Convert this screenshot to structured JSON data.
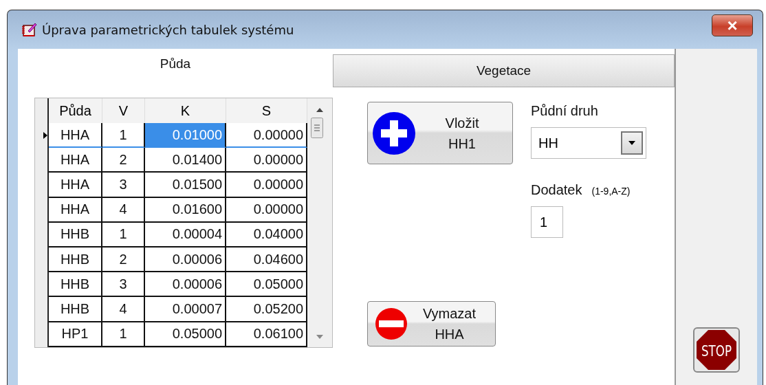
{
  "window": {
    "title": "Úprava parametrických tabulek systému",
    "close": "×"
  },
  "tabs": [
    {
      "label": "Půda",
      "selected": true
    },
    {
      "label": "Vegetace",
      "selected": false
    }
  ],
  "table": {
    "columns": [
      "Půda",
      "V",
      "K",
      "S"
    ],
    "rows": [
      {
        "current": true,
        "cells": [
          {
            "text": "HHA",
            "selected": false
          },
          {
            "text": "1",
            "selected": false
          },
          {
            "text": "0.01000",
            "selected": true
          },
          {
            "text": "0.00000",
            "selected": false
          }
        ]
      },
      {
        "current": false,
        "cells": [
          {
            "text": "HHA",
            "selected": false
          },
          {
            "text": "2",
            "selected": false
          },
          {
            "text": "0.01400",
            "selected": false
          },
          {
            "text": "0.00000",
            "selected": false
          }
        ]
      },
      {
        "current": false,
        "cells": [
          {
            "text": "HHA",
            "selected": false
          },
          {
            "text": "3",
            "selected": false
          },
          {
            "text": "0.01500",
            "selected": false
          },
          {
            "text": "0.00000",
            "selected": false
          }
        ]
      },
      {
        "current": false,
        "cells": [
          {
            "text": "HHA",
            "selected": false
          },
          {
            "text": "4",
            "selected": false
          },
          {
            "text": "0.01600",
            "selected": false
          },
          {
            "text": "0.00000",
            "selected": false
          }
        ]
      },
      {
        "current": false,
        "cells": [
          {
            "text": "HHB",
            "selected": false
          },
          {
            "text": "1",
            "selected": false
          },
          {
            "text": "0.00004",
            "selected": false
          },
          {
            "text": "0.04000",
            "selected": false
          }
        ]
      },
      {
        "current": false,
        "cells": [
          {
            "text": "HHB",
            "selected": false
          },
          {
            "text": "2",
            "selected": false
          },
          {
            "text": "0.00006",
            "selected": false
          },
          {
            "text": "0.04600",
            "selected": false
          }
        ]
      },
      {
        "current": false,
        "cells": [
          {
            "text": "HHB",
            "selected": false
          },
          {
            "text": "3",
            "selected": false
          },
          {
            "text": "0.00006",
            "selected": false
          },
          {
            "text": "0.05000",
            "selected": false
          }
        ]
      },
      {
        "current": false,
        "cells": [
          {
            "text": "HHB",
            "selected": false
          },
          {
            "text": "4",
            "selected": false
          },
          {
            "text": "0.00007",
            "selected": false
          },
          {
            "text": "0.05200",
            "selected": false
          }
        ]
      },
      {
        "current": false,
        "cells": [
          {
            "text": "HP1",
            "selected": false
          },
          {
            "text": "1",
            "selected": false
          },
          {
            "text": "0.05000",
            "selected": false
          },
          {
            "text": "0.06100",
            "selected": false
          }
        ]
      }
    ]
  },
  "insert_button": {
    "label": "Vložit",
    "value": "HH1"
  },
  "delete_button": {
    "label": "Vymazat",
    "value": "HHA"
  },
  "soil_type": {
    "label": "Půdní druh",
    "value": "HH"
  },
  "suffix": {
    "label": "Dodatek",
    "hint": "(1-9,A-Z)",
    "value": "1"
  },
  "stop_button": {
    "label": "STOP"
  }
}
